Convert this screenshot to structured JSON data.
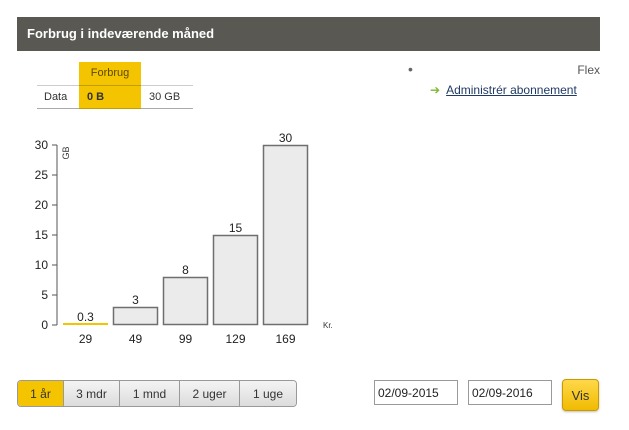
{
  "header": {
    "title": "Forbrug i indeværende måned"
  },
  "usage_table": {
    "column_header": "Forbrug",
    "row_label": "Data",
    "used": "0 B",
    "limit": "30 GB"
  },
  "plan": {
    "name": "Flex",
    "manage_label": "Administrér abonnement"
  },
  "chart_data": {
    "type": "bar",
    "categories": [
      "29",
      "49",
      "99",
      "129",
      "169"
    ],
    "values": [
      0.3,
      3,
      8,
      15,
      30
    ],
    "value_labels": [
      "0.3",
      "3",
      "8",
      "15",
      "30"
    ],
    "ylabel": "GB",
    "xlabel": "Kr.",
    "ylim": [
      0,
      30
    ],
    "yticks": [
      0,
      5,
      10,
      15,
      20,
      25,
      30
    ],
    "grid": false,
    "highlight_index": 0,
    "colors": {
      "bar": "#ebebeb",
      "bar_border": "#6f6f6f",
      "highlight": "#f5c400"
    }
  },
  "range_buttons": [
    {
      "label": "1 år",
      "active": true
    },
    {
      "label": "3 mdr",
      "active": false
    },
    {
      "label": "1 mnd",
      "active": false
    },
    {
      "label": "2 uger",
      "active": false
    },
    {
      "label": "1 uge",
      "active": false
    }
  ],
  "date_range": {
    "from": "02/09-2015",
    "to": "02/09-2016"
  },
  "submit": {
    "label": "Vis"
  },
  "colors": {
    "accent": "#f5c400",
    "header_bg": "#595853",
    "link": "#1f3a66",
    "arrow": "#7cb82f"
  }
}
